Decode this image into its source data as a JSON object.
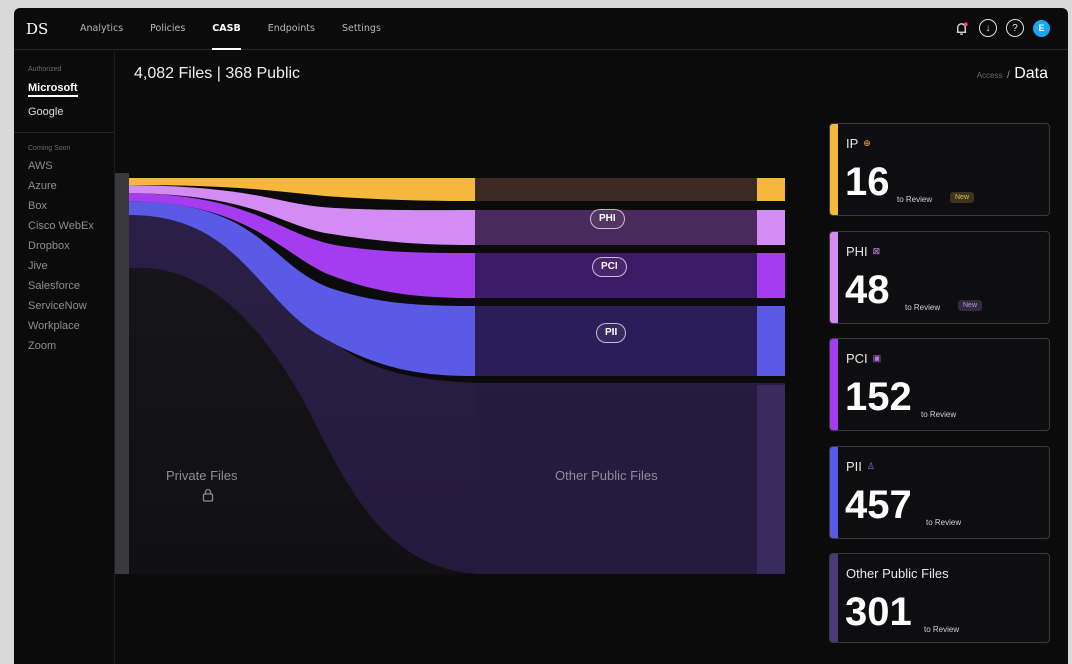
{
  "header": {
    "logo": "DS",
    "nav": [
      "Analytics",
      "Policies",
      "CASB",
      "Endpoints",
      "Settings"
    ],
    "active_nav": "CASB",
    "avatar_letter": "E"
  },
  "sidebar": {
    "authorized_label": "Authorized",
    "authorized": [
      "Microsoft",
      "Google"
    ],
    "coming_soon_label": "Coming Soon",
    "coming_soon": [
      "AWS",
      "Azure",
      "Box",
      "Cisco WebEx",
      "Dropbox",
      "Jive",
      "Salesforce",
      "ServiceNow",
      "Workplace",
      "Zoom"
    ]
  },
  "main": {
    "files_count": "4,082 Files",
    "separator": "|",
    "public_count": "368 Public",
    "breadcrumb_parent": "Access",
    "breadcrumb_sep": "/",
    "breadcrumb_current": "Data"
  },
  "flow": {
    "left_label": "Private Files",
    "right_label": "Other Public Files",
    "pills": [
      "PHI",
      "PCI",
      "PII"
    ],
    "colors": {
      "ip": "#f5b83d",
      "phi": "#d48cf5",
      "pci": "#a53cf0",
      "pii": "#5a5ae6",
      "other": "#3a2b5e"
    }
  },
  "cards": [
    {
      "label": "IP",
      "icon": "ip-icon",
      "value": "16",
      "review": "to Review",
      "badge": "New",
      "color": "#f5b83d"
    },
    {
      "label": "PHI",
      "icon": "phi-icon",
      "value": "48",
      "review": "to Review",
      "badge": "New",
      "color": "#d48cf5"
    },
    {
      "label": "PCI",
      "icon": "pci-icon",
      "value": "152",
      "review": "to Review",
      "badge": "",
      "color": "#a53cf0"
    },
    {
      "label": "PII",
      "icon": "pii-icon",
      "value": "457",
      "review": "to Review",
      "badge": "",
      "color": "#5a5ae6"
    },
    {
      "label": "Other Public Files",
      "icon": "",
      "value": "301",
      "review": "to Review",
      "badge": "",
      "color": "#4a3a78"
    }
  ]
}
